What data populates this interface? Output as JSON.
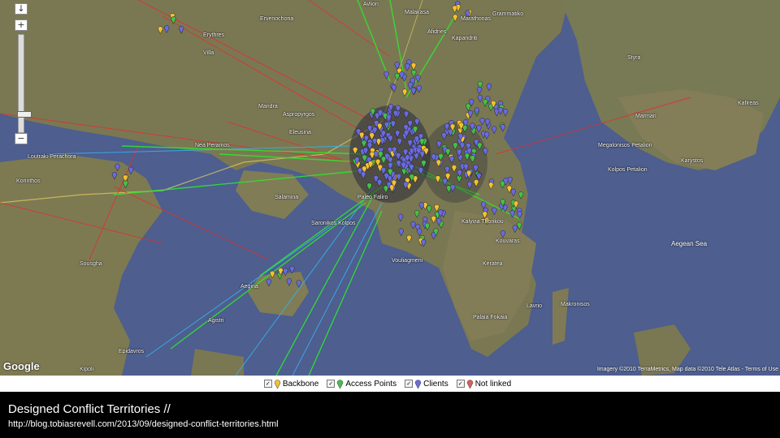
{
  "colors": {
    "backbone": "#f2c230",
    "access": "#44c04a",
    "client": "#6a6adf",
    "notlinked": "#e05a5a",
    "link_green": "#2ee82e",
    "link_red": "#e03030",
    "link_cyan": "#3ab0e8",
    "sea": "#4a5a8a",
    "land": "#7c7a55"
  },
  "map": {
    "logo": "Google",
    "copyright": "Imagery ©2010 TerraMetrics, Map data ©2010 Tele Atlas - Terms of Use",
    "zoom": {
      "plus": "+",
      "minus": "−"
    },
    "place_labels": [
      "Avlion",
      "Ervenochoria",
      "Malakasa",
      "Erythres",
      "Afidnes",
      "Grammatiko",
      "Marathonas",
      "Villa",
      "Kapandriti",
      "Styra",
      "Marmari",
      "Kafireas",
      "Mandra",
      "Aspropyrgos",
      "Eleusina",
      "Loutraki-Perachora",
      "Nea Peramos",
      "Korinthos",
      "Salamina",
      "Megalonisos Petalion",
      "Karystos",
      "Kolpos Petalion",
      "Paleo Faliro",
      "Vouliagmeni",
      "Saronikos Kolpos",
      "Sousgha",
      "Aegina",
      "Agistri",
      "Palaia Fokaia",
      "Kouvaras",
      "Lavrio",
      "Kalyvia Thorikou",
      "Keratea",
      "Makronisos",
      "Epidavros",
      "Kipoli",
      "Aegean Sea"
    ],
    "icons": {
      "zoom_in": "plus-icon",
      "zoom_out": "minus-icon",
      "marker": "map-pin-icon"
    }
  },
  "legend": {
    "items": [
      {
        "label": "Backbone",
        "checked": "✓"
      },
      {
        "label": "Access Points",
        "checked": "✓"
      },
      {
        "label": "Clients",
        "checked": "✓"
      },
      {
        "label": "Not linked",
        "checked": "✓"
      }
    ]
  },
  "caption": {
    "title": "Designed Conflict Territories //",
    "url": "http://blog.tobiasrevell.com/2013/09/designed-conflict-territories.html"
  }
}
